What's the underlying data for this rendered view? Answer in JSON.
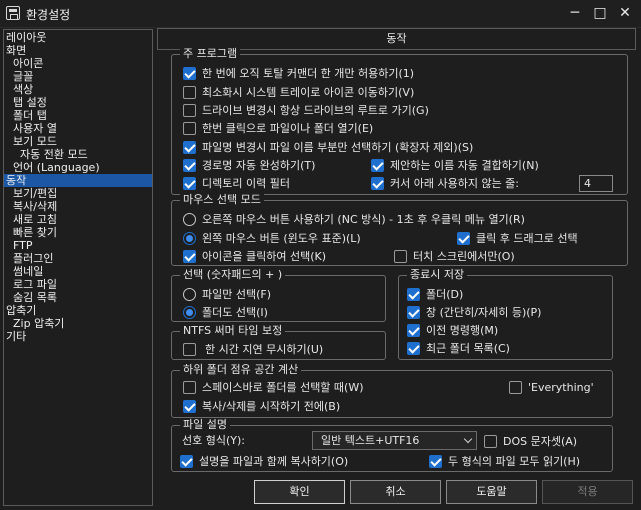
{
  "window": {
    "title": "환경설정",
    "minimize_glyph": "─",
    "maximize_glyph": "□",
    "close_glyph": "✕"
  },
  "sidebar": {
    "items": [
      {
        "label": "레이아웃"
      },
      {
        "label": "화면"
      },
      {
        "label": "아이콘"
      },
      {
        "label": "글꼴"
      },
      {
        "label": "색상"
      },
      {
        "label": "탭 설정"
      },
      {
        "label": "폴더 탭"
      },
      {
        "label": "사용자 열"
      },
      {
        "label": "보기 모드"
      },
      {
        "label": "자동 전환 모드"
      },
      {
        "label": "언어 (Language)"
      },
      {
        "label": "동작",
        "selected": true
      },
      {
        "label": "보기/편집"
      },
      {
        "label": "복사/삭제"
      },
      {
        "label": "새로 고침"
      },
      {
        "label": "빠른 찾기"
      },
      {
        "label": "FTP"
      },
      {
        "label": "플러그인"
      },
      {
        "label": "썸네일"
      },
      {
        "label": "로그 파일"
      },
      {
        "label": "숨김 목록"
      },
      {
        "label": "압축기"
      },
      {
        "label": "Zip 압축기"
      },
      {
        "label": "기타"
      }
    ]
  },
  "page_title": "동작",
  "main_program": {
    "title": "주 프로그램",
    "opt_single_instance": "한 번에 오직 토탈 커맨더 한 개만 허용하기(1)",
    "opt_minimize_tray": "최소화시 시스템 트레이로 아이콘 이동하기(V)",
    "opt_drive_root": "드라이브 변경시 항상 드라이브의 루트로 가기(G)",
    "opt_single_click": "한번 클릭으로 파일이나 폴더 열기(E)",
    "opt_select_name_only": "파일명 변경시 파일 이름 부분만 선택하기 (확장자 제외)(S)",
    "opt_path_autocomplete": "경로명 자동 완성하기(T)",
    "opt_suggest_join": "제안하는 이름 자동 결합하기(N)",
    "opt_dir_history_filter": "디렉토리 이력 필터",
    "opt_cursor_no_use": "커서 아래 사용하지 않는 줄:",
    "cursor_lines_value": "4"
  },
  "mouse_mode": {
    "title": "마우스 선택 모드",
    "opt_right_button": "오른쪽 마우스 버튼 사용하기 (NC 방식) - 1초 후 우클릭 메뉴 열기(R)",
    "opt_left_button": "왼쪽 마우스 버튼 (윈도우 표준)(L)",
    "opt_click_drag": "클릭 후 드래그로 선택",
    "opt_icon_click": "아이콘을 클릭하여 선택(K)",
    "opt_touch_only": "터치 스크린에서만(O)"
  },
  "selection": {
    "title": "선택 (숫자패드의 + )",
    "opt_files_only": "파일만 선택(F)",
    "opt_with_folders": "폴더도 선택(I)"
  },
  "save_on_exit": {
    "title": "종료시 저장",
    "opt_folders": "폴더(D)",
    "opt_window": "창 (간단히/자세히 등)(P)",
    "opt_history": "이전 명령행(M)",
    "opt_recent_folders": "최근 폴더 목록(C)"
  },
  "ntfs": {
    "title": "NTFS 써머 타임 보정",
    "opt_ignore_hour": "한 시간 지연 무시하기(U)"
  },
  "subdir_space": {
    "title": "하위 폴더 점유 공간 계산",
    "opt_spacebar": "스페이스바로 폴더를 선택할 때(W)",
    "opt_everything": "'Everything'",
    "opt_copy_delete": "복사/삭제를 시작하기 전에(B)"
  },
  "file_description": {
    "title": "파일 설명",
    "format_label": "선호 형식(Y):",
    "format_value": "일반 텍스트+UTF16",
    "opt_dos_charset": "DOS 문자셋(A)",
    "opt_copy_with_file": "설명을 파일과 함께 복사하기(O)",
    "opt_read_both": "두 형식의 파일 모두 읽기(H)"
  },
  "buttons": {
    "ok": "확인",
    "cancel": "취소",
    "help": "도움말",
    "apply": "적용"
  }
}
